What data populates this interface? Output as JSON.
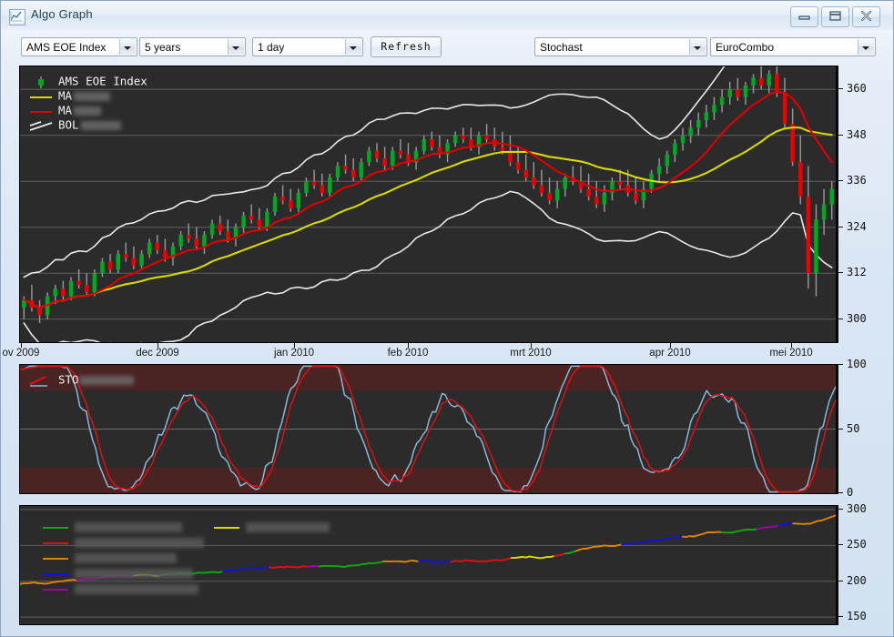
{
  "window": {
    "title": "Algo Graph",
    "icon": "chart-line-icon",
    "buttons": {
      "minimize": "minimize-icon",
      "maximize": "maximize-icon",
      "close": "close-icon"
    }
  },
  "toolbar": {
    "symbol": {
      "value": "AMS EOE Index",
      "name": "symbol-select"
    },
    "range": {
      "value": "5 years",
      "name": "range-select"
    },
    "interval": {
      "value": "1 day",
      "name": "interval-select"
    },
    "refresh_label": "Refresh",
    "indicator": {
      "value": "Stochast",
      "name": "indicator-select"
    },
    "strategy": {
      "value": "EuroCombo",
      "name": "strategy-select"
    }
  },
  "colors": {
    "candle_up": "#00a824",
    "candle_down": "#ee0000",
    "wick": "#9a9a9a",
    "ma_fast": "#d8d800",
    "ma_slow": "#e00000",
    "bollinger": "#e8e8e8",
    "stoch_k": "#8ab8d8",
    "stoch_d": "#e01010",
    "stoch_band": "#4a2323",
    "panel_bg": "#2b2b2b",
    "grid": "#6a6a6a",
    "signal_green": "#11a711",
    "signal_yellow": "#dada00",
    "signal_red": "#e01010",
    "signal_orange": "#e08000",
    "signal_blue": "#1111e0",
    "signal_purple": "#a000a0"
  },
  "price_panel": {
    "legend": [
      {
        "label": "AMS EOE Index",
        "swatch": "candle",
        "blurred": false,
        "blur_width": 0
      },
      {
        "label": "MA",
        "swatch": "line-yellow",
        "blurred": true,
        "blur_width": 40
      },
      {
        "label": "MA",
        "swatch": "line-red",
        "blurred": true,
        "blur_width": 30
      },
      {
        "label": "BOL",
        "swatch": "line-white-slope",
        "blurred": true,
        "blur_width": 44
      }
    ],
    "y_ticks": [
      300,
      312,
      324,
      336,
      348,
      360
    ],
    "y_min": 294,
    "y_max": 366
  },
  "x_axis": {
    "labels": [
      "ov 2009",
      "dec 2009",
      "jan 2010",
      "feb 2010",
      "mrt 2010",
      "apr 2010",
      "mei 2010"
    ],
    "positions": [
      22,
      172,
      322,
      447,
      582,
      735,
      868
    ]
  },
  "stoch_panel": {
    "legend": [
      {
        "label": "STO",
        "swatch": "line-pair",
        "blurred": true,
        "blur_width": 60
      }
    ],
    "y_ticks": [
      0,
      50,
      100
    ],
    "y_min": 0,
    "y_max": 100,
    "overbought": 80,
    "oversold": 20
  },
  "signal_panel": {
    "legend": [
      {
        "swatch": "line-green",
        "blurred": true,
        "blur_width": 118,
        "col": 1
      },
      {
        "swatch": "line-yellow",
        "blurred": true,
        "blur_width": 92,
        "col": 2
      },
      {
        "swatch": "line-red",
        "blurred": true,
        "blur_width": 142,
        "col": 1
      },
      {
        "swatch": "line-orange",
        "blurred": true,
        "blur_width": 112,
        "col": 1
      },
      {
        "swatch": "line-blue",
        "blurred": true,
        "blur_width": 130,
        "col": 1
      },
      {
        "swatch": "line-purple",
        "blurred": true,
        "blur_width": 136,
        "col": 1
      }
    ],
    "y_ticks": [
      150,
      200,
      250,
      300
    ],
    "y_min": 140,
    "y_max": 305
  },
  "chart_data": {
    "type": "line",
    "title": "AMS EOE Index",
    "xlabel": "",
    "ylabel": "",
    "panels": [
      {
        "name": "price",
        "type": "candlestick",
        "ylim": [
          294,
          366
        ],
        "yticks": [
          300,
          312,
          324,
          336,
          348,
          360
        ],
        "xticklabels": [
          "ov 2009",
          "dec 2009",
          "jan 2010",
          "feb 2010",
          "mrt 2010",
          "apr 2010",
          "mei 2010"
        ],
        "series": [
          {
            "name": "AMS EOE Index",
            "type": "candles",
            "up_color": "#00a824",
            "down_color": "#ee0000"
          },
          {
            "name": "MA",
            "type": "line",
            "color": "#d8d800"
          },
          {
            "name": "MA",
            "type": "line",
            "color": "#e00000"
          },
          {
            "name": "BOL",
            "type": "band",
            "color": "#e8e8e8"
          }
        ],
        "ohlc": [
          [
            303,
            306,
            300,
            305
          ],
          [
            305,
            309,
            302,
            303
          ],
          [
            303,
            305,
            299,
            301
          ],
          [
            301,
            307,
            300,
            306
          ],
          [
            306,
            309,
            304,
            308
          ],
          [
            308,
            310,
            305,
            306
          ],
          [
            306,
            311,
            305,
            310
          ],
          [
            310,
            313,
            308,
            309
          ],
          [
            309,
            312,
            306,
            307
          ],
          [
            307,
            313,
            306,
            312
          ],
          [
            312,
            316,
            311,
            315
          ],
          [
            315,
            317,
            312,
            313
          ],
          [
            313,
            318,
            312,
            317
          ],
          [
            317,
            320,
            315,
            316
          ],
          [
            316,
            319,
            313,
            314
          ],
          [
            314,
            318,
            313,
            317
          ],
          [
            317,
            321,
            316,
            320
          ],
          [
            320,
            322,
            317,
            318
          ],
          [
            318,
            321,
            315,
            316
          ],
          [
            316,
            320,
            314,
            319
          ],
          [
            319,
            323,
            318,
            322
          ],
          [
            322,
            325,
            320,
            321
          ],
          [
            321,
            324,
            318,
            319
          ],
          [
            319,
            323,
            317,
            322
          ],
          [
            322,
            326,
            321,
            325
          ],
          [
            325,
            327,
            322,
            323
          ],
          [
            323,
            326,
            320,
            321
          ],
          [
            321,
            325,
            319,
            324
          ],
          [
            324,
            328,
            322,
            327
          ],
          [
            327,
            330,
            325,
            326
          ],
          [
            326,
            329,
            323,
            324
          ],
          [
            324,
            329,
            323,
            328
          ],
          [
            328,
            333,
            327,
            332
          ],
          [
            332,
            335,
            330,
            331
          ],
          [
            331,
            334,
            328,
            329
          ],
          [
            329,
            334,
            328,
            333
          ],
          [
            333,
            337,
            332,
            336
          ],
          [
            336,
            339,
            334,
            335
          ],
          [
            335,
            338,
            332,
            333
          ],
          [
            333,
            338,
            332,
            337
          ],
          [
            337,
            341,
            336,
            340
          ],
          [
            340,
            343,
            338,
            339
          ],
          [
            339,
            342,
            336,
            337
          ],
          [
            337,
            342,
            336,
            341
          ],
          [
            341,
            345,
            340,
            344
          ],
          [
            344,
            346,
            341,
            342
          ],
          [
            342,
            345,
            339,
            340
          ],
          [
            340,
            345,
            339,
            344
          ],
          [
            344,
            347,
            342,
            343
          ],
          [
            343,
            346,
            340,
            341
          ],
          [
            341,
            345,
            339,
            344
          ],
          [
            344,
            348,
            343,
            347
          ],
          [
            347,
            349,
            344,
            345
          ],
          [
            345,
            348,
            342,
            343
          ],
          [
            343,
            347,
            341,
            346
          ],
          [
            346,
            349,
            345,
            348
          ],
          [
            348,
            350,
            346,
            347
          ],
          [
            347,
            350,
            344,
            345
          ],
          [
            345,
            349,
            343,
            348
          ],
          [
            348,
            351,
            346,
            347
          ],
          [
            347,
            350,
            344,
            345
          ],
          [
            345,
            349,
            343,
            344
          ],
          [
            344,
            348,
            340,
            341
          ],
          [
            341,
            345,
            338,
            339
          ],
          [
            339,
            343,
            336,
            337
          ],
          [
            337,
            341,
            334,
            335
          ],
          [
            335,
            339,
            332,
            333
          ],
          [
            333,
            337,
            330,
            331
          ],
          [
            331,
            336,
            329,
            334
          ],
          [
            334,
            338,
            332,
            337
          ],
          [
            337,
            340,
            335,
            336
          ],
          [
            336,
            340,
            333,
            334
          ],
          [
            334,
            338,
            331,
            332
          ],
          [
            332,
            336,
            329,
            330
          ],
          [
            330,
            335,
            328,
            333
          ],
          [
            333,
            337,
            331,
            336
          ],
          [
            336,
            339,
            334,
            335
          ],
          [
            335,
            339,
            332,
            333
          ],
          [
            333,
            337,
            330,
            331
          ],
          [
            331,
            336,
            329,
            334
          ],
          [
            334,
            339,
            333,
            338
          ],
          [
            338,
            342,
            336,
            340
          ],
          [
            340,
            344,
            338,
            343
          ],
          [
            343,
            347,
            341,
            346
          ],
          [
            346,
            350,
            344,
            348
          ],
          [
            348,
            352,
            346,
            350
          ],
          [
            350,
            354,
            348,
            352
          ],
          [
            352,
            356,
            350,
            354
          ],
          [
            354,
            358,
            352,
            356
          ],
          [
            356,
            360,
            354,
            358
          ],
          [
            358,
            362,
            356,
            360
          ],
          [
            360,
            363,
            357,
            358
          ],
          [
            358,
            362,
            356,
            361
          ],
          [
            361,
            364,
            359,
            363
          ],
          [
            363,
            366,
            360,
            361
          ],
          [
            361,
            365,
            359,
            364
          ],
          [
            364,
            366,
            358,
            359
          ],
          [
            359,
            363,
            350,
            351
          ],
          [
            351,
            355,
            340,
            341
          ],
          [
            341,
            348,
            330,
            332
          ],
          [
            332,
            340,
            308,
            312
          ],
          [
            312,
            330,
            306,
            326
          ],
          [
            326,
            334,
            322,
            330
          ],
          [
            330,
            336,
            326,
            334
          ]
        ]
      },
      {
        "name": "stochastic",
        "type": "line",
        "ylim": [
          0,
          100
        ],
        "yticks": [
          0,
          50,
          100
        ],
        "series": [
          {
            "name": "%K",
            "color": "#8ab8d8"
          },
          {
            "name": "%D",
            "color": "#e01010"
          }
        ]
      },
      {
        "name": "signal",
        "type": "line",
        "ylim": [
          140,
          305
        ],
        "yticks": [
          150,
          200,
          250,
          300
        ],
        "series": [
          {
            "name": "equity",
            "segmented": true
          }
        ]
      }
    ]
  }
}
